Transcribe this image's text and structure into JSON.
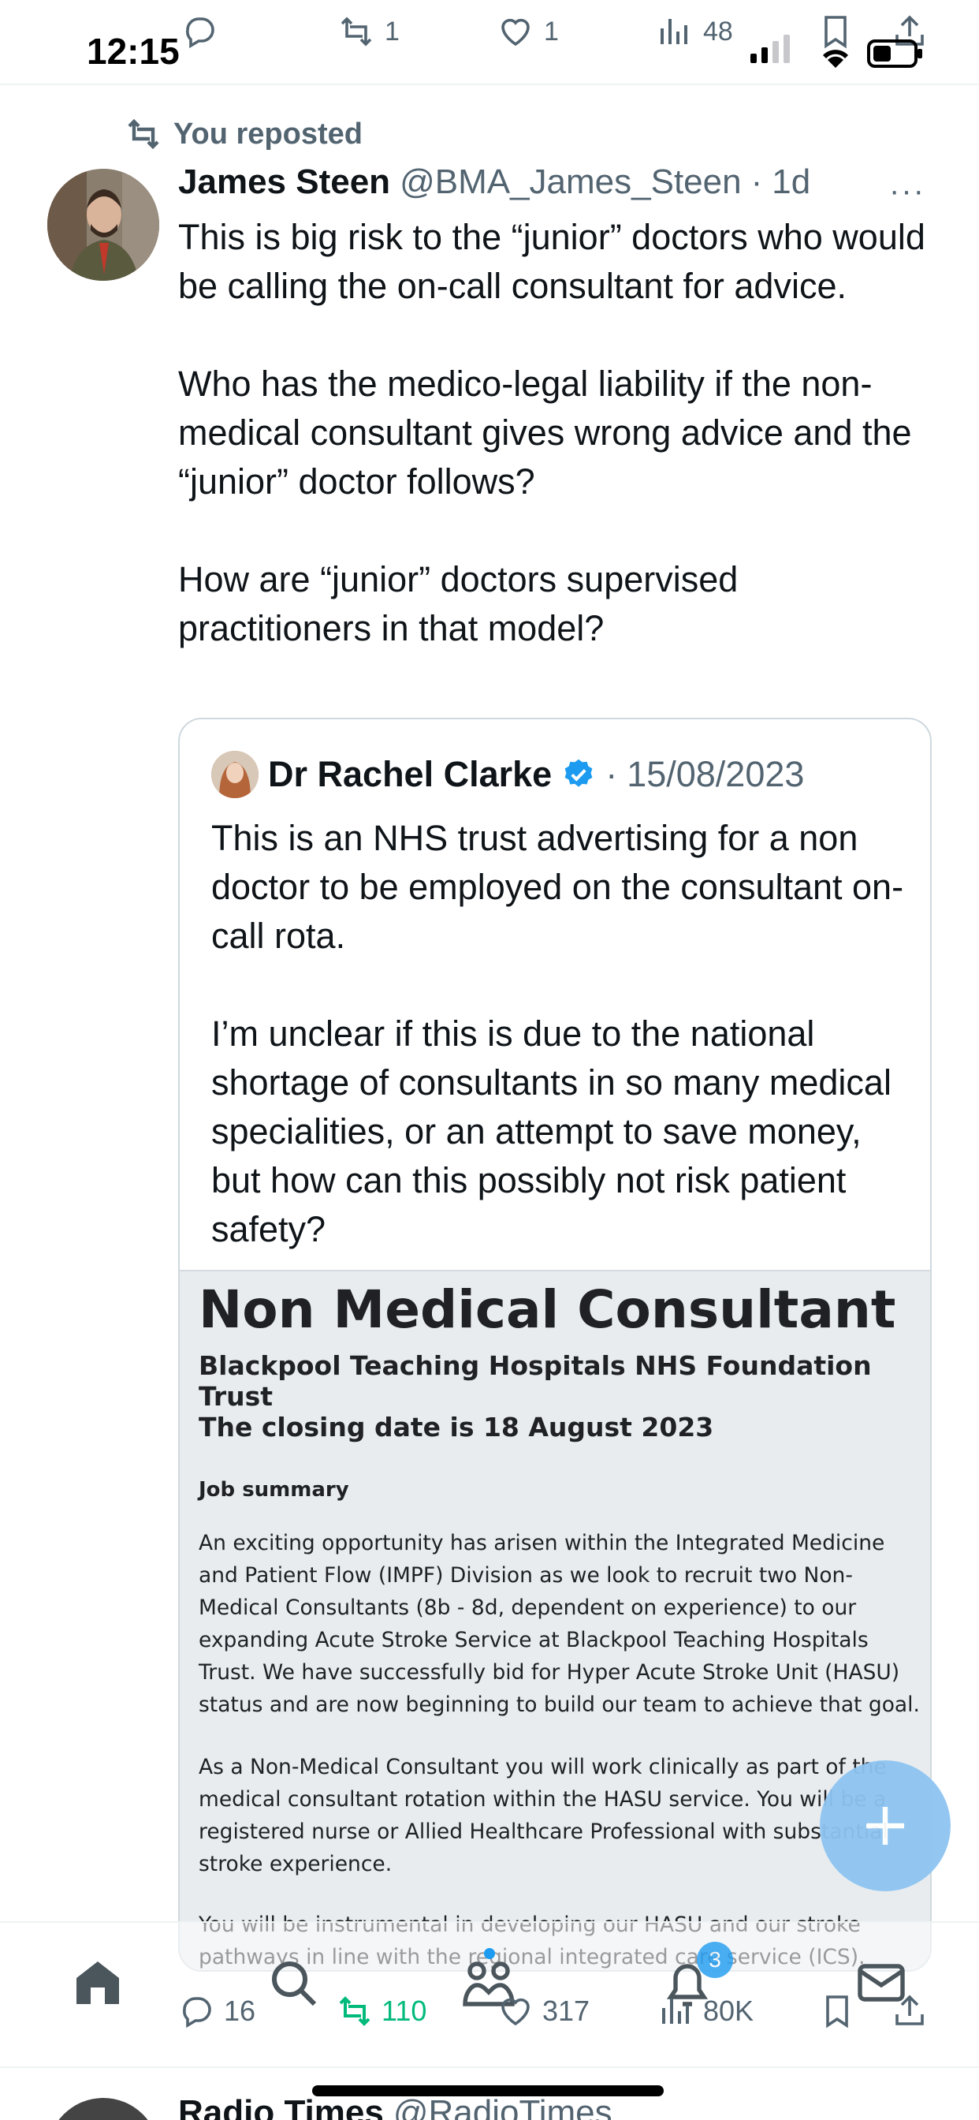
{
  "status_bar": {
    "time": "12:15",
    "reply_count": "",
    "retweet_count": "1",
    "like_count": "1",
    "views_count": "48"
  },
  "repost_label": "You reposted",
  "tweet": {
    "author_name": "James Steen",
    "author_handle": "@BMA_James_Steen",
    "separator": "·",
    "age": "1d",
    "more": "···",
    "text": "This is big risk to the “junior” doctors who would be calling the on-call consultant for advice.\n\nWho has the medico-legal liability if the non-medical consultant gives wrong advice and the “junior” doctor follows?\n\nHow are “junior” doctors supervised practitioners in that model?",
    "stats": {
      "replies": "16",
      "reposts": "110",
      "likes": "317",
      "views": "80K"
    }
  },
  "quote": {
    "author_name": "Dr Rachel Clarke",
    "separator": "·",
    "date": "15/08/2023",
    "text": "This is an NHS trust advertising for a non doctor to be employed on the consultant on-call rota.\n\nI’m unclear if this is due to the national shortage of consultants in so many medical specialities, or an attempt to save money, but how can this possibly not risk patient safety?",
    "image": {
      "title": "Non Medical Consultant",
      "trust": "Blackpool Teaching Hospitals NHS Foundation Trust",
      "closing": "The closing date is 18 August 2023",
      "summary_heading": "Job summary",
      "para1": "An exciting opportunity has arisen within the Integrated Medicine and Patient Flow (IMPF) Division as we look to recruit two Non-Medical Consultants (8b - 8d, dependent on experience) to our expanding Acute Stroke Service at Blackpool Teaching Hospitals Trust. We have successfully bid for Hyper Acute Stroke Unit (HASU) status and are now beginning to build our team to achieve that goal.",
      "para2": "As a Non-Medical Consultant you will work clinically as part of the medical consultant rotation within the HASU service. You will be a registered nurse or Allied Healthcare Professional with substantial stroke experience.",
      "para3": "You will be instrumental in developing our HASU and our stroke pathways in line with the regional integrated care service (ICS)."
    }
  },
  "notifications_badge": "3",
  "next_tweet": {
    "author_name": "Radio Times",
    "author_handle": "@RadioTimes"
  },
  "colors": {
    "accent": "#1d9bf0",
    "repost_green": "#00ba7c",
    "secondary_text": "#536471"
  }
}
